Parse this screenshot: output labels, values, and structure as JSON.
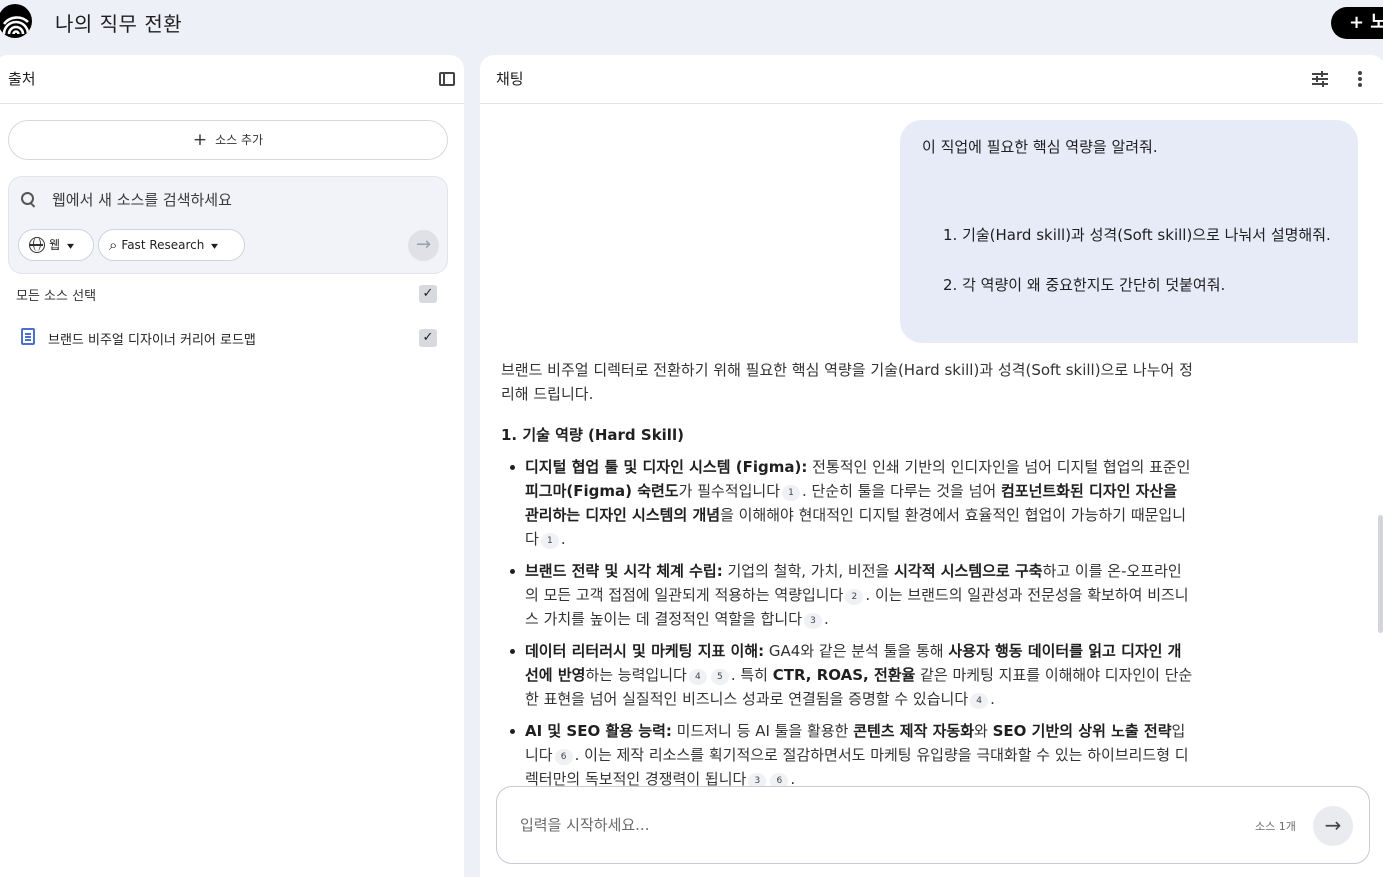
{
  "app": {
    "title": "나의 직무 전환",
    "new_button_label": "+ 노"
  },
  "sources": {
    "title": "출처",
    "add_source_label": "소스 추가",
    "search": {
      "placeholder": "웹에서 새 소스를 검색하세요",
      "value": ""
    },
    "chips": {
      "web": "웹",
      "research": "Fast Research"
    },
    "select_all_label": "모든 소스 선택",
    "items": [
      {
        "label": "브랜드 비주얼 디자이너 커리어 로드맵",
        "checked": true
      }
    ]
  },
  "chat": {
    "title": "채팅",
    "user_message": {
      "line1": "이 직업에 필요한 핵심 역량을 알려줘.",
      "items": [
        "1. 기술(Hard skill)과 성격(Soft skill)으로 나눠서 설명해줘.",
        "2. 각 역량이 왜 중요한지도 간단히 덧붙여줘."
      ]
    },
    "answer": {
      "intro": "브랜드 비주얼 디렉터로 전환하기 위해 필요한 핵심 역량을 기술(Hard skill)과 성격(Soft skill)으로 나누어 정리해 드립니다.",
      "heading": "1. 기술 역량 (Hard Skill)",
      "bullets": [
        {
          "title": "디지털 협업 툴 및 디자인 시스템 (Figma):",
          "t1": " 전통적인 인쇄 기반의 인디자인을 넘어 디지털 협업의 표준인 ",
          "b1": "피그마(Figma) 숙련도",
          "t2": "가 필수적입니다",
          "c1": "1",
          "t3": ". 단순히 툴을 다루는 것을 넘어 ",
          "b2": "컴포넌트화된 디자인 자산을 관리하는 디자인 시스템의 개념",
          "t4": "을 이해해야 현대적인 디지털 환경에서 효율적인 협업이 가능하기 때문입니다",
          "c2": "1",
          "t5": "."
        },
        {
          "title": "브랜드 전략 및 시각 체계 수립:",
          "t1": " 기업의 철학, 가치, 비전을 ",
          "b1": "시각적 시스템으로 구축",
          "t2": "하고 이를 온-오프라인의 모든 고객 접점에 일관되게 적용하는 역량입니다",
          "c1": "2",
          "t3": ". 이는 브랜드의 일관성과 전문성을 확보하여 비즈니스 가치를 높이는 데 결정적인 역할을 합니다",
          "c2": "3",
          "t4": "."
        },
        {
          "title": "데이터 리터러시 및 마케팅 지표 이해:",
          "t1": " GA4와 같은 분석 툴을 통해 ",
          "b1": "사용자 행동 데이터를 읽고 디자인 개선에 반영",
          "t2": "하는 능력입니다",
          "c1": "4",
          "c2": "5",
          "t3": ". 특히 ",
          "b2": "CTR, ROAS, 전환율",
          "t4": " 같은 마케팅 지표를 이해해야 디자인이 단순한 표현을 넘어 실질적인 비즈니스 성과로 연결됨을 증명할 수 있습니다",
          "c3": "4",
          "t5": "."
        },
        {
          "title": "AI 및 SEO 활용 능력:",
          "t1": " 미드저니 등 AI 툴을 활용한 ",
          "b1": "콘텐츠 제작 자동화",
          "t2": "와 ",
          "b2": "SEO 기반의 상위 노출 전략",
          "t3": "입니다",
          "c1": "6",
          "t4": ". 이는 제작 리소스를 획기적으로 절감하면서도 마케팅 유입량을 극대화할 수 있는 하이브리드형 디렉터만의 독보적인 경쟁력이 됩니다",
          "c2": "3",
          "c3": "6",
          "t5": "."
        }
      ]
    },
    "composer": {
      "placeholder": "입력을 시작하세요...",
      "source_count": "소스 1개"
    }
  }
}
